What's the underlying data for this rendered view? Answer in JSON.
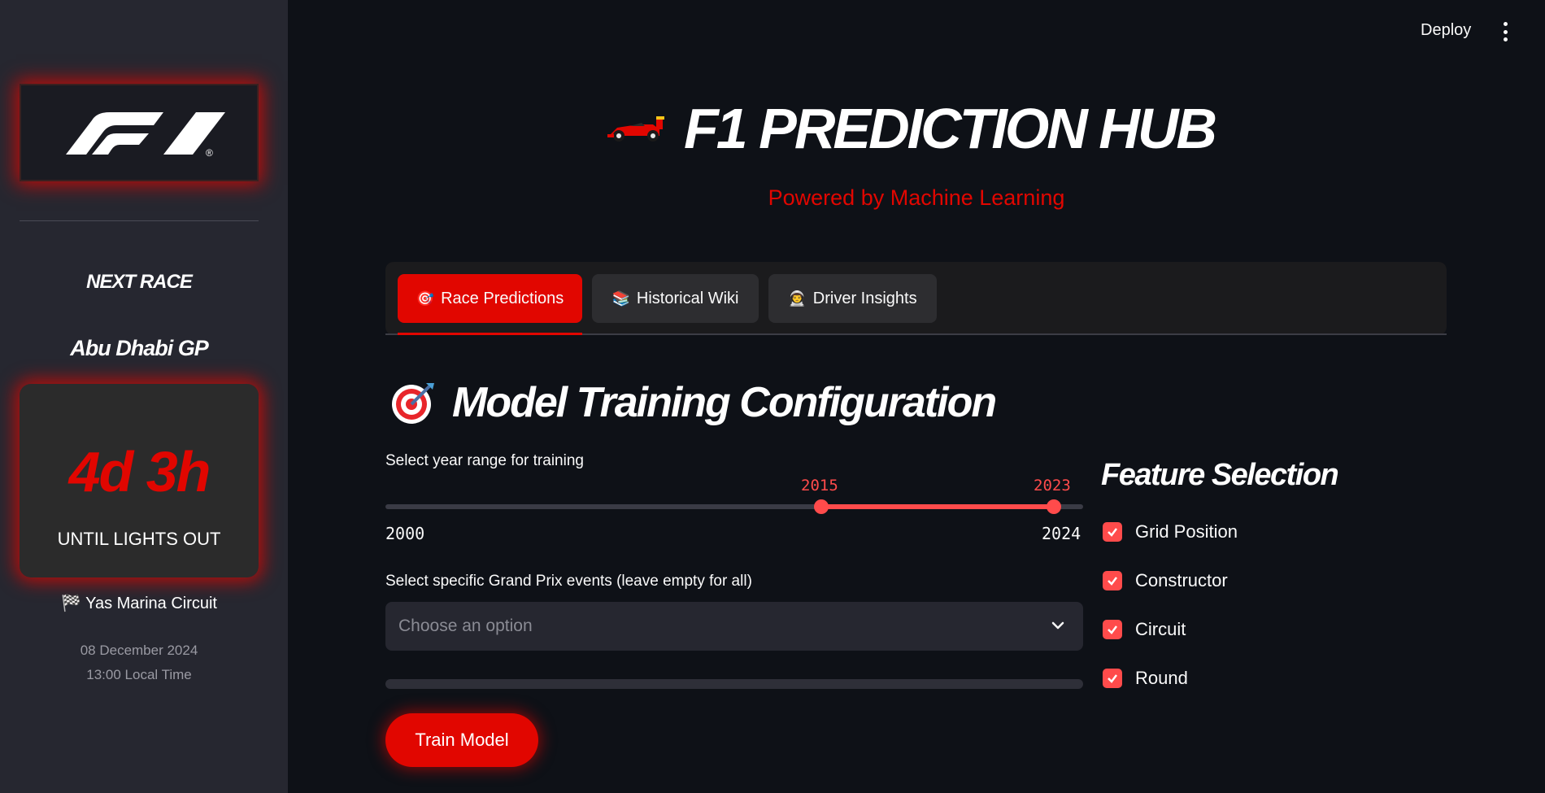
{
  "header": {
    "deploy_label": "Deploy",
    "title": "F1 PREDICTION HUB",
    "subtitle": "Powered by Machine Learning"
  },
  "sidebar": {
    "logo": "F1",
    "next_race_label": "NEXT RACE",
    "race_name": "Abu Dhabi GP",
    "countdown": "4d 3h",
    "countdown_caption": "UNTIL LIGHTS OUT",
    "circuit": "Yas Marina Circuit",
    "date": "08 December 2024",
    "local_time": "13:00 Local Time"
  },
  "tabs": [
    {
      "label": "Race Predictions",
      "icon": "🎯",
      "active": true
    },
    {
      "label": "Historical Wiki",
      "icon": "📚",
      "active": false
    },
    {
      "label": "Driver Insights",
      "icon": "👨‍🚀",
      "active": false
    }
  ],
  "main": {
    "section_title": "Model Training Configuration",
    "section_icon": "🎯",
    "year_range": {
      "label": "Select year range for training",
      "min": "2000",
      "max": "2024",
      "selected_start": "2015",
      "selected_end": "2023"
    },
    "gp_select": {
      "label": "Select specific Grand Prix events (leave empty for all)",
      "placeholder": "Choose an option"
    },
    "train_button": "Train Model"
  },
  "features": {
    "title": "Feature Selection",
    "items": [
      {
        "label": "Grid Position",
        "checked": true
      },
      {
        "label": "Constructor",
        "checked": true
      },
      {
        "label": "Circuit",
        "checked": true
      },
      {
        "label": "Round",
        "checked": true
      }
    ]
  },
  "colors": {
    "accent": "#e10600",
    "slider": "#ff4b4b",
    "background": "#0e1117",
    "sidebar": "#262730"
  }
}
